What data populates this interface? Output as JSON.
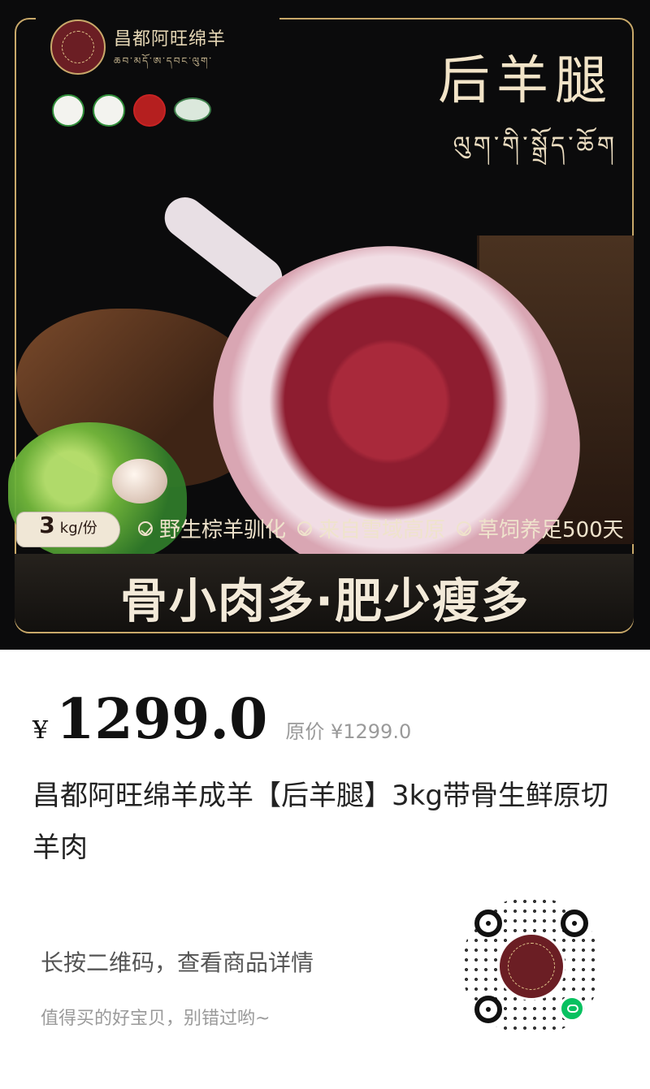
{
  "hero": {
    "brand_name": "昌都阿旺绵羊",
    "brand_tibetan": "ཆབ་མདོ་ཨ་དབང་ལུག་",
    "title_cn": "后羊腿",
    "title_tibetan": "ལུག་གི་སྒྲོད་ཆོག",
    "weight_number": "3",
    "weight_unit": "kg/份",
    "features": [
      "野生棕羊驯化",
      "来自雪域高原",
      "草饲养足500天"
    ],
    "slogan": "骨小肉多·肥少瘦多",
    "colors": {
      "accent": "#c9a96a",
      "dark_bg": "#0b0b0c",
      "brand_red": "#6b1e24"
    }
  },
  "product": {
    "currency": "¥",
    "price": "1299.0",
    "original_price_label": "原价 ¥1299.0",
    "title": "昌都阿旺绵羊成羊【后羊腿】3kg带骨生鲜原切羊肉"
  },
  "qr": {
    "instruction": "长按二维码，查看商品详情",
    "subtext": "值得买的好宝贝，别错过哟~"
  }
}
